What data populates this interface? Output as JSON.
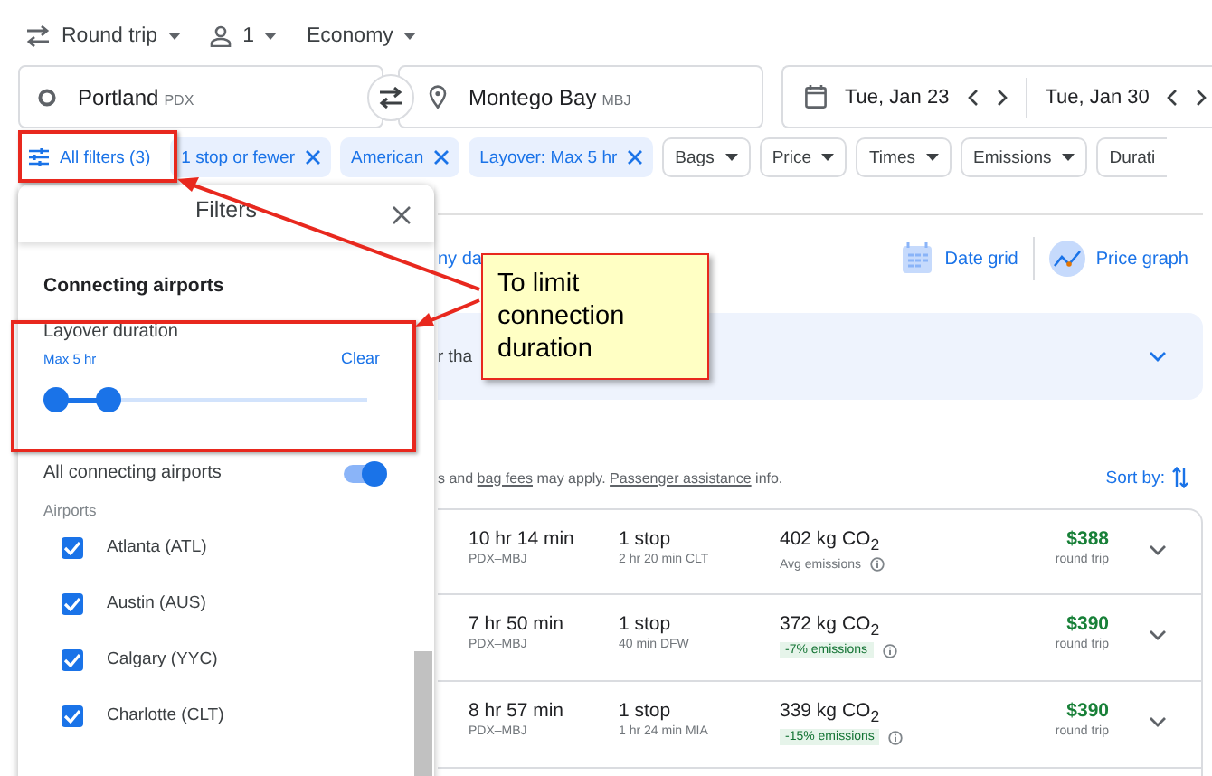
{
  "trip_options": [
    {
      "kind": "trip",
      "label": "Round trip"
    },
    {
      "kind": "passengers",
      "label": "1"
    },
    {
      "kind": "cabin",
      "label": "Economy"
    }
  ],
  "search": {
    "origin": {
      "city": "Portland",
      "code": "PDX"
    },
    "destination": {
      "city": "Montego Bay",
      "code": "MBJ"
    },
    "departure": "Tue, Jan 23",
    "return": "Tue, Jan 30"
  },
  "filter_chips": [
    {
      "kind": "all",
      "label": "All filters (3)"
    },
    {
      "kind": "applied",
      "label": "1 stop or fewer"
    },
    {
      "kind": "applied",
      "label": "American"
    },
    {
      "kind": "applied",
      "label": "Layover: Max 5 hr"
    },
    {
      "kind": "menu",
      "label": "Bags"
    },
    {
      "kind": "menu",
      "label": "Price"
    },
    {
      "kind": "menu",
      "label": "Times"
    },
    {
      "kind": "menu",
      "label": "Emissions"
    },
    {
      "kind": "cut",
      "label": "Durati"
    }
  ],
  "toolbar": {
    "covered_link": "ny da",
    "date_grid": "Date grid",
    "price_graph": "Price graph"
  },
  "banner": {
    "covered_text": "r tha"
  },
  "notice": [
    {
      "kind": "plain",
      "text": "s and "
    },
    {
      "kind": "link",
      "text": "bag fees"
    },
    {
      "kind": "plain",
      "text": " may apply. "
    },
    {
      "kind": "link",
      "text": "Passenger assistance"
    },
    {
      "kind": "plain",
      "text": " info."
    }
  ],
  "sort_by": "Sort by:",
  "flights": [
    {
      "duration": "10 hr 14 min",
      "route": "PDX–MBJ",
      "stops": "1 stop",
      "layover": "2 hr 20 min CLT",
      "emissions": "402 kg CO$_{2}$",
      "emissions_note": {
        "kind": "average",
        "label": "Avg emissions"
      },
      "price": "$388",
      "price_note": "round trip"
    },
    {
      "duration": "7 hr 50 min",
      "route": "PDX–MBJ",
      "stops": "1 stop",
      "layover": "40 min DFW",
      "emissions": "372 kg CO$_{2}$",
      "emissions_note": {
        "kind": "lower",
        "label": "-7% emissions"
      },
      "price": "$390",
      "price_note": "round trip"
    },
    {
      "duration": "8 hr 57 min",
      "route": "PDX–MBJ",
      "stops": "1 stop",
      "layover": "1 hr 24 min MIA",
      "emissions": "339 kg CO$_{2}$",
      "emissions_note": {
        "kind": "lower",
        "label": "-15% emissions"
      },
      "price": "$390",
      "price_note": "round trip"
    }
  ],
  "filters_panel": {
    "title": "Filters",
    "section": "Connecting airports",
    "layover": {
      "label": "Layover duration",
      "value": "Max 5 hr",
      "clear": "Clear",
      "level": 0.17
    },
    "all_airports": {
      "label": "All connecting airports",
      "on": true
    },
    "airports_heading": "Airports",
    "airports": [
      {
        "name": "Atlanta (ATL)",
        "checked": true
      },
      {
        "name": "Austin (AUS)",
        "checked": true
      },
      {
        "name": "Calgary (YYC)",
        "checked": true
      },
      {
        "name": "Charlotte (CLT)",
        "checked": true
      }
    ]
  },
  "annotation": {
    "callout": "To limit connection duration"
  }
}
